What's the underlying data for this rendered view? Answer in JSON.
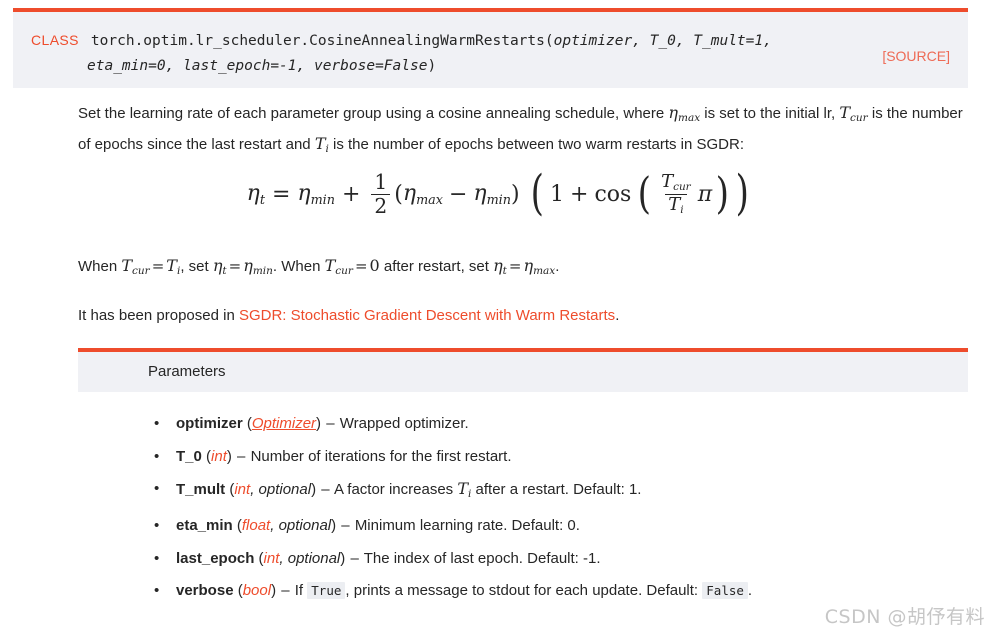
{
  "colors": {
    "accent": "#ee4c2c",
    "panel_bg": "#f0f1f5",
    "text": "#262626",
    "code_bg": "#eceef2",
    "watermark": "#c6c6c6"
  },
  "signature": {
    "kind_label": "CLASS",
    "qualified_name": "torch.optim.lr_scheduler.CosineAnnealingWarmRestarts",
    "open_paren": "(",
    "line1_args": "optimizer, T_0, T_mult=1,",
    "line2_args": "eta_min=0, last_epoch=-1, verbose=False",
    "close_paren": ")",
    "full_signature": "torch.optim.lr_scheduler.CosineAnnealingWarmRestarts(optimizer, T_0, T_mult=1, eta_min=0, last_epoch=-1, verbose=False)",
    "source_link": "[SOURCE]"
  },
  "description": {
    "part1": "Set the learning rate of each parameter group using a cosine annealing schedule, where ",
    "eta_max": "η",
    "eta_max_sub": "max",
    "part2": " is set to the initial lr, ",
    "t_cur": "T",
    "t_cur_sub": "cur",
    "part3": " is the number of epochs since the last restart and ",
    "t_i": "T",
    "t_i_sub": "i",
    "part4": " is the number of epochs between two warm restarts in SGDR:"
  },
  "formula": {
    "latex": "\\eta_t = \\eta_{min} + \\frac{1}{2}(\\eta_{max} - \\eta_{min})\\left(1 + \\cos\\left(\\frac{T_{cur}}{T_i}\\pi\\right)\\right)",
    "eta": "η",
    "sub_t": "t",
    "equals": "=",
    "sub_min": "min",
    "plus": "+",
    "num": "1",
    "den": "2",
    "lparen": "(",
    "sub_max": "max",
    "minus": "−",
    "rparen": ")",
    "one": "1",
    "cos": "cos",
    "T": "T",
    "sub_cur": "cur",
    "sub_i": "i",
    "pi": "π"
  },
  "when_line": {
    "when1": "When ",
    "t": "T",
    "sub_cur": "cur",
    "eq": "=",
    "sub_i": "i",
    "comma_set": ", set ",
    "eta": "η",
    "sub_t": "t",
    "sub_min": "min",
    "mid": ". When ",
    "zero": "0",
    "after": " after restart, set ",
    "sub_max": "max",
    "period": "."
  },
  "proposed": {
    "prefix": "It has been proposed in ",
    "link_text": "SGDR: Stochastic Gradient Descent with Warm Restarts",
    "suffix": "."
  },
  "parameters": {
    "section_title": "Parameters",
    "items": [
      {
        "name": "optimizer",
        "type": "Optimizer",
        "type_is_link": true,
        "optional": "",
        "desc_before": "Wrapped optimizer.",
        "desc_after": "",
        "math": "",
        "math_sub": "",
        "code": "",
        "default_label": "",
        "default_value": "",
        "default_code": ""
      },
      {
        "name": "T_0",
        "type": "int",
        "type_is_link": false,
        "optional": "",
        "desc_before": "Number of iterations for the first restart.",
        "desc_after": "",
        "math": "",
        "math_sub": "",
        "code": "",
        "default_label": "",
        "default_value": "",
        "default_code": ""
      },
      {
        "name": "T_mult",
        "type": "int",
        "type_is_link": false,
        "optional": ", optional",
        "desc_before": "A factor increases ",
        "math": "T",
        "math_sub": "i",
        "desc_after": " after a restart. ",
        "code": "",
        "default_label": "Default: ",
        "default_value": "1.",
        "default_code": ""
      },
      {
        "name": "eta_min",
        "type": "float",
        "type_is_link": false,
        "optional": ", optional",
        "desc_before": "Minimum learning rate. ",
        "math": "",
        "math_sub": "",
        "desc_after": "",
        "code": "",
        "default_label": "Default: ",
        "default_value": "0.",
        "default_code": ""
      },
      {
        "name": "last_epoch",
        "type": "int",
        "type_is_link": false,
        "optional": ", optional",
        "desc_before": "The index of last epoch. ",
        "math": "",
        "math_sub": "",
        "desc_after": "",
        "code": "",
        "default_label": "Default: ",
        "default_value": "-1.",
        "default_code": ""
      },
      {
        "name": "verbose",
        "type": "bool",
        "type_is_link": false,
        "optional": "",
        "desc_before": "If ",
        "math": "",
        "math_sub": "",
        "code": "True",
        "desc_after": ", prints a message to stdout for each update. ",
        "default_label": "Default: ",
        "default_value": "",
        "default_code": "False"
      }
    ],
    "dash": "–",
    "paren_open": "(",
    "paren_close": ")",
    "bullet": "•",
    "trailing_period": "."
  },
  "watermark": {
    "text": "CSDN @胡伃有料"
  }
}
